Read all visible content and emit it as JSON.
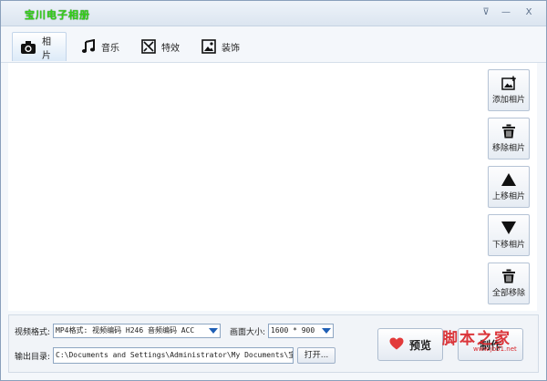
{
  "window": {
    "title": "宝川电子相册",
    "buttons": [
      {
        "name": "menu-dropdown-button",
        "glyph": "⊽"
      },
      {
        "name": "minimize-button",
        "glyph": "—"
      },
      {
        "name": "close-button",
        "glyph": "X"
      }
    ]
  },
  "tabs": [
    {
      "label": "相片",
      "icon": "camera-icon",
      "active": true
    },
    {
      "label": "音乐",
      "icon": "music-note-icon",
      "active": false
    },
    {
      "label": "特效",
      "icon": "effects-icon",
      "active": false
    },
    {
      "label": "装饰",
      "icon": "picture-frame-icon",
      "active": false
    }
  ],
  "side_buttons": [
    {
      "label": "添加相片",
      "icon": "add-photo-icon"
    },
    {
      "label": "移除相片",
      "icon": "trash-icon"
    },
    {
      "label": "上移相片",
      "icon": "triangle-up-icon"
    },
    {
      "label": "下移相片",
      "icon": "triangle-down-icon"
    },
    {
      "label": "全部移除",
      "icon": "trash-all-icon"
    }
  ],
  "bottom": {
    "format_label": "视频格式:",
    "format_value": "MP4格式: 视频编码 H246 音频编码 ACC",
    "size_label": "画面大小:",
    "size_value": "1600 * 900",
    "output_label": "输出目录:",
    "output_path": "C:\\Documents and Settings\\Administrator\\My Documents\\宝川电",
    "open_label": "打开...",
    "preview_label": "预览",
    "make_label": "制作"
  },
  "watermark": {
    "main": "脚本之家",
    "sub": "www.jb51.net"
  },
  "colors": {
    "title_green": "#34d019",
    "accent_blue": "#1f5fb5",
    "heart_red": "#e23a3a",
    "watermark_red": "#d9262b"
  }
}
